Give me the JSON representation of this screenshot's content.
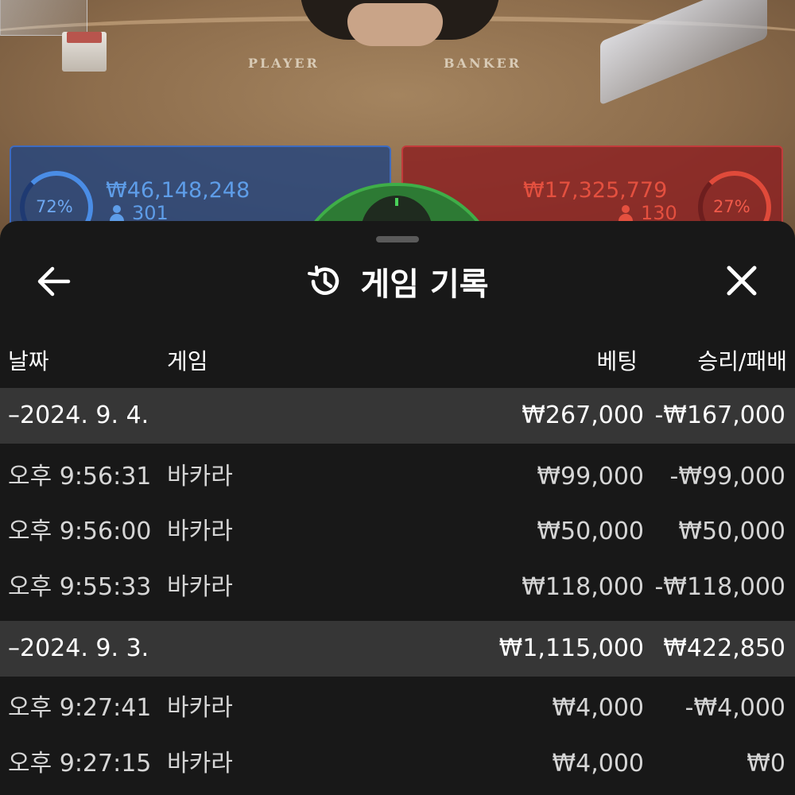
{
  "table": {
    "player_label": "PLAYER",
    "banker_label": "BANKER",
    "player": {
      "percent": "72%",
      "amount": "₩46,148,248",
      "count": "301",
      "color": "#4a8de6"
    },
    "banker": {
      "percent": "27%",
      "amount": "₩17,325,779",
      "count": "130",
      "color": "#e04a3a"
    }
  },
  "sheet": {
    "title": "게임 기록",
    "icons": {
      "back": "arrow-left-icon",
      "history": "history-icon",
      "close": "close-icon"
    },
    "columns": {
      "date": "날짜",
      "game": "게임",
      "bet": "베팅",
      "result": "승리/패배"
    },
    "groups": [
      {
        "date": "–2024. 9. 4.",
        "bet": "₩267,000",
        "result": "-₩167,000",
        "rows": [
          {
            "time": "오후 9:56:31",
            "game": "바카라",
            "bet": "₩99,000",
            "result": "-₩99,000"
          },
          {
            "time": "오후 9:56:00",
            "game": "바카라",
            "bet": "₩50,000",
            "result": "₩50,000"
          },
          {
            "time": "오후 9:55:33",
            "game": "바카라",
            "bet": "₩118,000",
            "result": "-₩118,000"
          }
        ]
      },
      {
        "date": "–2024. 9. 3.",
        "bet": "₩1,115,000",
        "result": "₩422,850",
        "rows": [
          {
            "time": "오후 9:27:41",
            "game": "바카라",
            "bet": "₩4,000",
            "result": "-₩4,000"
          },
          {
            "time": "오후 9:27:15",
            "game": "바카라",
            "bet": "₩4,000",
            "result": "₩0"
          }
        ]
      }
    ]
  }
}
